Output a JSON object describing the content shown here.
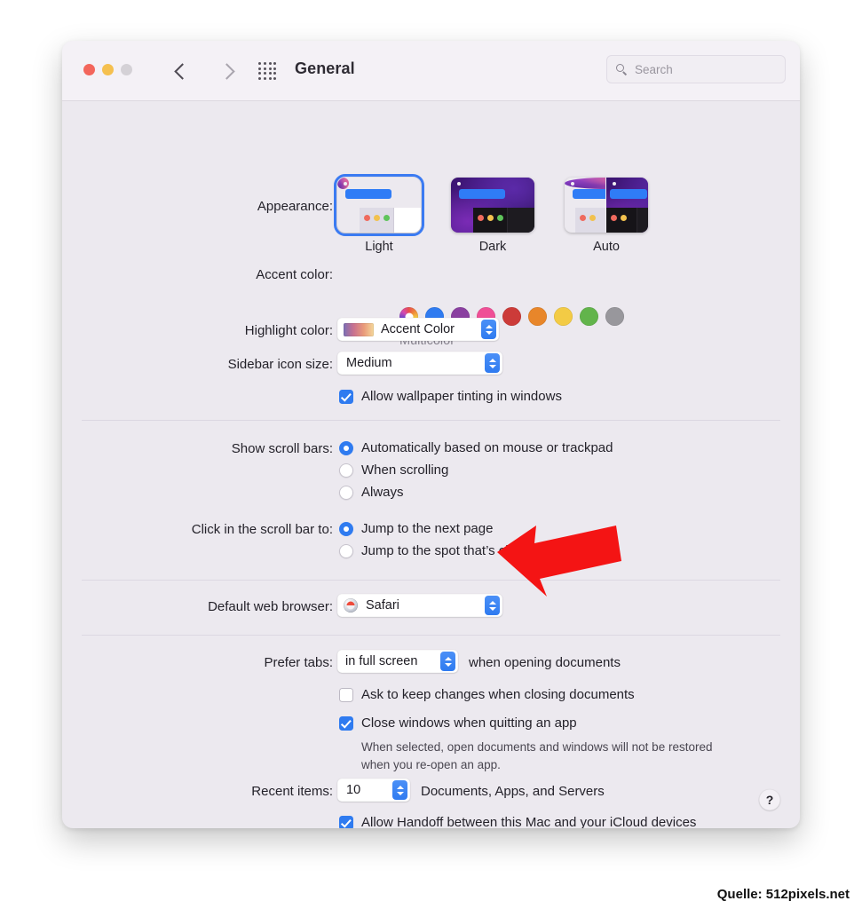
{
  "window": {
    "title": "General",
    "traffic_lights": [
      "close",
      "minimize",
      "zoom"
    ],
    "nav": {
      "back": "back-chevron",
      "forward": "forward-chevron",
      "grid": "show-all-grid"
    },
    "search": {
      "placeholder": "Search",
      "value": "",
      "icon": "search-icon"
    },
    "help_label": "?"
  },
  "appearance": {
    "label": "Appearance:",
    "options": [
      {
        "label": "Light",
        "selected": true
      },
      {
        "label": "Dark",
        "selected": false
      },
      {
        "label": "Auto",
        "selected": false
      }
    ]
  },
  "accent": {
    "label": "Accent color:",
    "caption": "Multicolor",
    "swatches": [
      {
        "name": "multicolor",
        "color": "multicolor",
        "selected": true
      },
      {
        "name": "blue",
        "color": "#2f7bf0",
        "selected": false
      },
      {
        "name": "purple",
        "color": "#8a3fa0",
        "selected": false
      },
      {
        "name": "pink",
        "color": "#ef4f96",
        "selected": false
      },
      {
        "name": "red",
        "color": "#cc3b39",
        "selected": false
      },
      {
        "name": "orange",
        "color": "#e8862a",
        "selected": false
      },
      {
        "name": "yellow",
        "color": "#f3cb45",
        "selected": false
      },
      {
        "name": "green",
        "color": "#62b44b",
        "selected": false
      },
      {
        "name": "graphite",
        "color": "#98979c",
        "selected": false
      }
    ]
  },
  "highlight": {
    "label": "Highlight color:",
    "value": "Accent Color"
  },
  "sidebar_icon_size": {
    "label": "Sidebar icon size:",
    "value": "Medium"
  },
  "wallpaper_tinting": {
    "label": "Allow wallpaper tinting in windows",
    "checked": true
  },
  "scroll_bars": {
    "label": "Show scroll bars:",
    "options": [
      {
        "label": "Automatically based on mouse or trackpad",
        "selected": true
      },
      {
        "label": "When scrolling",
        "selected": false
      },
      {
        "label": "Always",
        "selected": false
      }
    ]
  },
  "scroll_click": {
    "label": "Click in the scroll bar to:",
    "options": [
      {
        "label": "Jump to the next page",
        "selected": true
      },
      {
        "label": "Jump to the spot that’s clicked",
        "selected": false
      }
    ]
  },
  "default_browser": {
    "label": "Default web browser:",
    "value": "Safari",
    "icon": "safari-icon"
  },
  "prefer_tabs": {
    "label": "Prefer tabs:",
    "value": "in full screen",
    "suffix": "when opening documents"
  },
  "ask_keep_changes": {
    "label": "Ask to keep changes when closing documents",
    "checked": false
  },
  "close_windows": {
    "label": "Close windows when quitting an app",
    "checked": true,
    "note_line1": "When selected, open documents and windows will not be restored",
    "note_line2": "when you re-open an app."
  },
  "recent_items": {
    "label": "Recent items:",
    "value": "10",
    "suffix": "Documents, Apps, and Servers"
  },
  "handoff": {
    "label": "Allow Handoff between this Mac and your iCloud devices",
    "checked": true
  },
  "annotation": {
    "arrow_color": "#f41414",
    "points_to": "default-web-browser-popup"
  },
  "caption": "Quelle: 512pixels.net"
}
